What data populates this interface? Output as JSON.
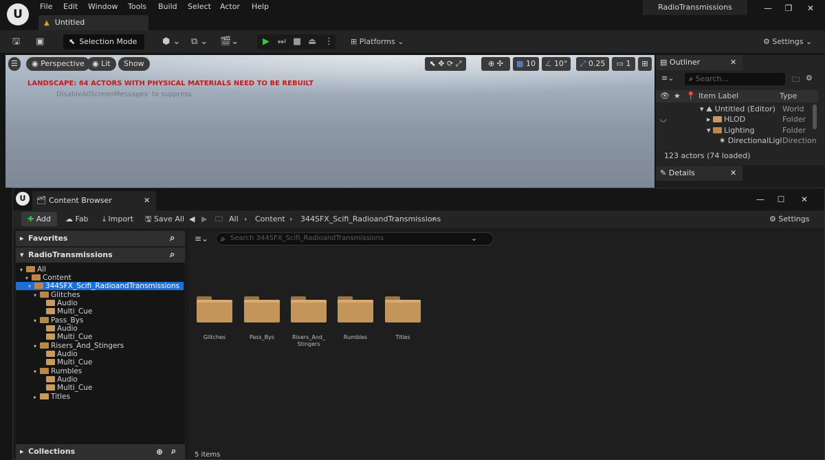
{
  "app": {
    "logo": "U",
    "menu": [
      "File",
      "Edit",
      "Window",
      "Tools",
      "Build",
      "Select",
      "Actor",
      "Help"
    ],
    "doc_tab": "Untitled",
    "project": "RadioTransmissions"
  },
  "toolbar": {
    "selection_mode": "Selection Mode",
    "platforms": "Platforms",
    "settings": "Settings"
  },
  "viewport": {
    "perspective": "Perspective",
    "lit": "Lit",
    "show": "Show",
    "grid_snap": "10",
    "rot_snap": "10°",
    "scale_snap": "0.25",
    "camera_speed": "1",
    "warning": "LANDSCAPE: 64 ACTORS WITH PHYSICAL MATERIALS NEED TO BE REBUILT",
    "suppress": "DisableAllScreenMessages' to suppress"
  },
  "outliner": {
    "title": "Outliner",
    "search_placeholder": "Search...",
    "col_label": "Item Label",
    "col_type": "Type",
    "rows": [
      {
        "label": "Untitled (Editor)",
        "type": "World"
      },
      {
        "label": "HLOD",
        "type": "Folder"
      },
      {
        "label": "Lighting",
        "type": "Folder"
      },
      {
        "label": "DirectionalLigl",
        "type": "Direction"
      }
    ],
    "status": "123 actors (74 loaded)"
  },
  "details": {
    "title": "Details"
  },
  "content_browser": {
    "title": "Content Browser",
    "add": "Add",
    "fab": "Fab",
    "import": "Import",
    "save_all": "Save All",
    "breadcrumb": [
      "All",
      "Content",
      "344SFX_Scifi_RadioandTransmissions"
    ],
    "settings": "Settings",
    "favorites": "Favorites",
    "project_section": "RadioTransmissions",
    "collections": "Collections",
    "search_placeholder": "Search 344SFX_Scifi_RadioandTransmissions",
    "tree": [
      {
        "label": "All"
      },
      {
        "label": "Content"
      },
      {
        "label": "344SFX_Scifi_RadioandTransmissions"
      },
      {
        "label": "Glitches"
      },
      {
        "label": "Audio"
      },
      {
        "label": "Multi_Cue"
      },
      {
        "label": "Pass_Bys"
      },
      {
        "label": "Audio"
      },
      {
        "label": "Multi_Cue"
      },
      {
        "label": "Risers_And_Stingers"
      },
      {
        "label": "Audio"
      },
      {
        "label": "Multi_Cue"
      },
      {
        "label": "Rumbles"
      },
      {
        "label": "Audio"
      },
      {
        "label": "Multi_Cue"
      },
      {
        "label": "Titles"
      }
    ],
    "assets": [
      "Glitches",
      "Pass_Bys",
      "Risers_And_\nStingers",
      "Rumbles",
      "Titles"
    ],
    "item_count": "5 items"
  }
}
